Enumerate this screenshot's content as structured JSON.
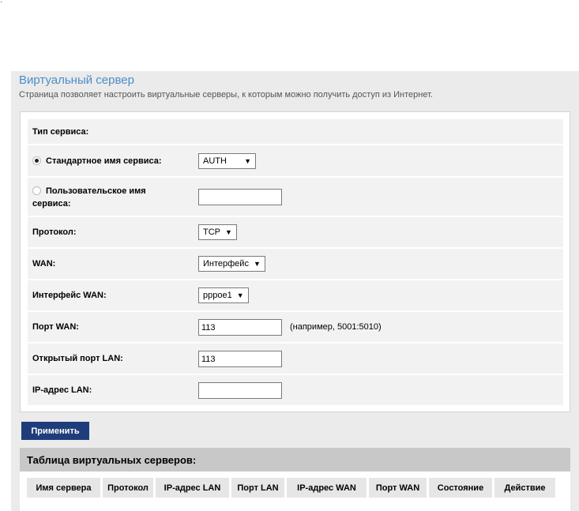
{
  "page": {
    "title": "Виртуальный сервер",
    "description": "Страница позволяет настроить виртуальные серверы, к которым можно получить доступ из Интернет."
  },
  "form": {
    "service_type_label": "Тип сервиса:",
    "standard_service_label": "Стандартное имя сервиса:",
    "standard_service_selected": true,
    "standard_service_value": "AUTH",
    "custom_service_label": "Пользовательское имя сервиса:",
    "custom_service_value": "",
    "protocol_label": "Протокол:",
    "protocol_value": "TCP",
    "wan_label": "WAN:",
    "wan_value": "Интерфейс",
    "wan_interface_label": "Интерфейс WAN:",
    "wan_interface_value": "pppoe1",
    "wan_port_label": "Порт WAN:",
    "wan_port_value": "113",
    "wan_port_hint": "(например, 5001:5010)",
    "lan_port_label": "Открытый порт LAN:",
    "lan_port_value": "113",
    "lan_ip_label": "IP-адрес LAN:",
    "lan_ip_value": ""
  },
  "apply_button": "Применить",
  "table": {
    "title": "Таблица виртуальных серверов:",
    "columns": [
      "Имя сервера",
      "Протокол",
      "IP-адрес LAN",
      "Порт LAN",
      "IP-адрес WAN",
      "Порт WAN",
      "Состояние",
      "Действие"
    ]
  },
  "colors": {
    "title": "#4a8ec9",
    "button": "#1f3d7a",
    "table_header": "#c8c8c8"
  },
  "icons": {
    "select_arrow": "triangle-down-icon",
    "radio": "radio-icon"
  }
}
